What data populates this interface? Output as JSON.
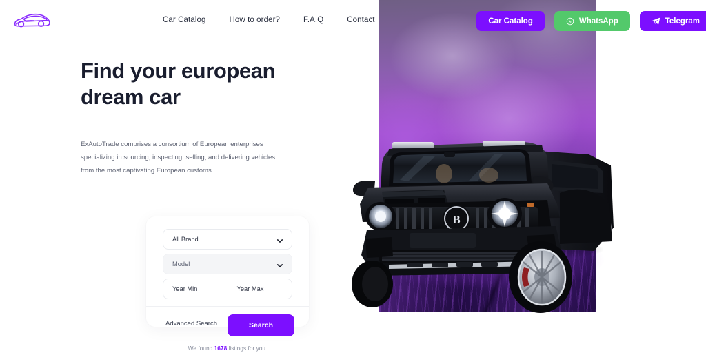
{
  "header": {
    "logo_name": "exautotrade-car-logo",
    "nav": [
      {
        "label": "Car Catalog"
      },
      {
        "label": "How to order?"
      },
      {
        "label": "F.A.Q"
      },
      {
        "label": "Contact"
      }
    ],
    "buttons": [
      {
        "label": "Car Catalog",
        "icon": "none",
        "color": "#7C0FFF"
      },
      {
        "label": "WhatsApp",
        "icon": "whatsapp-icon",
        "color": "#53C96B"
      },
      {
        "label": "Telegram",
        "icon": "telegram-icon",
        "color": "#7C0FFF"
      }
    ]
  },
  "hero": {
    "headline": "Find your european dream car",
    "subtext": "ExAutoTrade comprises a consortium of European enterprises specializing in sourcing, inspecting, selling, and delivering vehicles from the most captivating European customs.",
    "image_alt": "black-brabus-g-class-suv-on-purple-smoke-background"
  },
  "search": {
    "brand": {
      "value": "All Brand",
      "placeholder": "All Brand"
    },
    "model": {
      "value": "Model",
      "placeholder": "Model",
      "disabled": true
    },
    "year_min": {
      "value": "Year Min",
      "placeholder": "Year Min"
    },
    "year_max": {
      "value": "Year Max",
      "placeholder": "Year Max"
    },
    "advanced_label": "Advanced Search",
    "search_label": "Search",
    "listing_prefix": "We found ",
    "listing_count": "1678",
    "listing_suffix": " listings for you."
  },
  "colors": {
    "accent_purple": "#7C0FFF",
    "whatsapp_green": "#53C96B",
    "heading": "#191d2e",
    "body_text": "#5f6474"
  }
}
